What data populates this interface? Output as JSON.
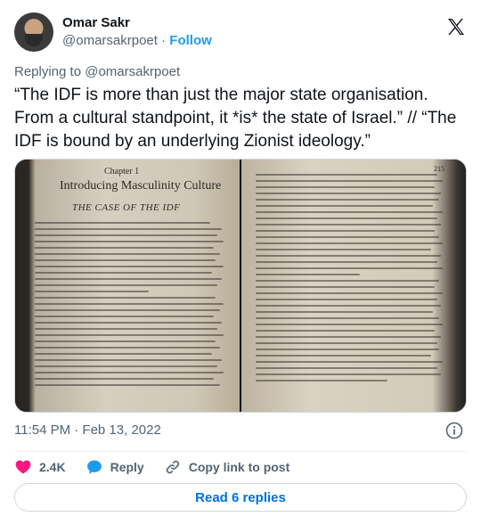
{
  "author": {
    "name": "Omar Sakr",
    "handle": "@omarsakrpoet",
    "separator": "·",
    "follow_label": "Follow"
  },
  "reply_context": "Replying to @omarsakrpoet",
  "tweet": {
    "text": "“The IDF is more than just the major state organisation. From a cultural standpoint, it *is* the state of Israel.” // “The IDF is bound by an underlying Zionist ideology.”"
  },
  "media": {
    "left_page": {
      "chapter": "Chapter 1",
      "title": "Introducing Masculinity Culture",
      "subheading": "THE CASE OF THE IDF"
    },
    "right_page": {
      "page_number": "215"
    }
  },
  "timestamp": "11:54 PM · Feb 13, 2022",
  "actions": {
    "like_count": "2.4K",
    "reply_label": "Reply",
    "copy_link_label": "Copy link to post"
  },
  "read_replies_label": "Read 6 replies",
  "icons": {
    "brand": "x-logo-icon",
    "info": "info-icon",
    "like": "heart-icon",
    "reply": "reply-bubble-icon",
    "copy": "link-icon"
  },
  "colors": {
    "accent": "#1d9bf0",
    "like": "#f91880",
    "muted": "#536471",
    "text": "#0f1419"
  }
}
